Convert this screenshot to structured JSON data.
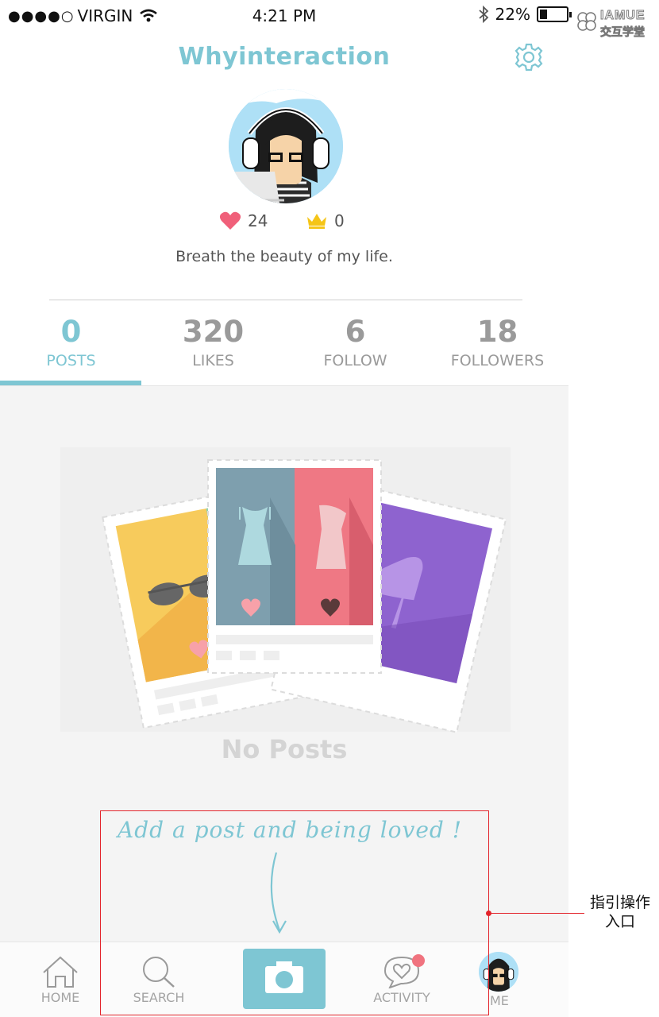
{
  "status_bar": {
    "signal_dots": "●●●●○",
    "carrier": "VIRGIN",
    "time": "4:21 PM",
    "battery": "22%",
    "battery_level": 0.22
  },
  "watermark": {
    "top": "IAMUE",
    "bottom": "交互学堂"
  },
  "header": {
    "title": "Whyinteraction"
  },
  "profile": {
    "hearts": "24",
    "crowns": "0",
    "bio": "Breath the beauty of my life."
  },
  "tabs": [
    {
      "count": "0",
      "label": "POSTS",
      "active": true
    },
    {
      "count": "320",
      "label": "LIKES",
      "active": false
    },
    {
      "count": "6",
      "label": "FOLLOW",
      "active": false
    },
    {
      "count": "18",
      "label": "FOLLOWERS",
      "active": false
    }
  ],
  "empty_state": {
    "title": "No Posts",
    "hint": "Add a post and being loved !"
  },
  "nav": [
    {
      "label": "HOME",
      "icon": "home-icon"
    },
    {
      "label": "SEARCH",
      "icon": "search-icon"
    },
    {
      "label": "",
      "icon": "camera-icon"
    },
    {
      "label": "ACTIVITY",
      "icon": "chat-heart-icon"
    },
    {
      "label": "ME",
      "icon": "avatar"
    }
  ],
  "annotation": {
    "line1": "指引操作",
    "line2": "入口"
  },
  "colors": {
    "accent": "#7ec6d3",
    "heart": "#f0607a",
    "crown": "#f5c518",
    "annotation": "#e3242b"
  }
}
